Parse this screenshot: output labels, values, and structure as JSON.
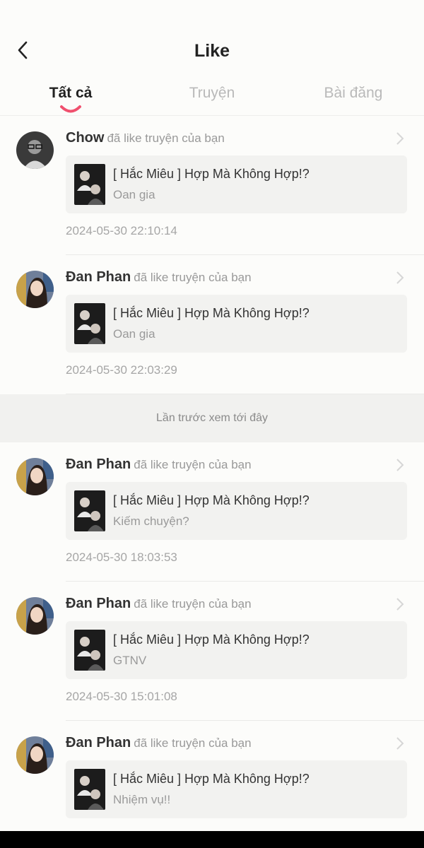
{
  "header": {
    "title": "Like"
  },
  "tabs": [
    {
      "label": "Tất cả"
    },
    {
      "label": "Truyện"
    },
    {
      "label": "Bài đăng"
    }
  ],
  "colors": {
    "accent": "#f0506e",
    "background": "#fcfcfa"
  },
  "icons": {
    "back": "chevron-left-icon",
    "item_arrow": "chevron-right-icon"
  },
  "items": [
    {
      "user": "Chow",
      "action": "đã like truyện của bạn",
      "story_title": "[ Hắc Miêu ] Hợp Mà Không Hợp!?",
      "chapter": "Oan gia",
      "time": "2024-05-30 22:10:14"
    },
    {
      "user": "Đan Phan",
      "action": "đã like truyện của bạn",
      "story_title": "[ Hắc Miêu ] Hợp Mà Không Hợp!?",
      "chapter": "Oan gia",
      "time": "2024-05-30 22:03:29"
    },
    {
      "user": "Đan Phan",
      "action": "đã like truyện của bạn",
      "story_title": "[ Hắc Miêu ] Hợp Mà Không Hợp!?",
      "chapter": "Kiếm chuyện?",
      "time": "2024-05-30 18:03:53"
    },
    {
      "user": "Đan Phan",
      "action": "đã like truyện của bạn",
      "story_title": "[ Hắc Miêu ] Hợp Mà Không Hợp!?",
      "chapter": "GTNV",
      "time": "2024-05-30 15:01:08"
    },
    {
      "user": "Đan Phan",
      "action": "đã like truyện của bạn",
      "story_title": "[ Hắc Miêu ] Hợp Mà Không Hợp!?",
      "chapter": "Nhiệm vụ!!",
      "time": ""
    }
  ],
  "separator": {
    "label": "Lần trước xem tới đây"
  }
}
